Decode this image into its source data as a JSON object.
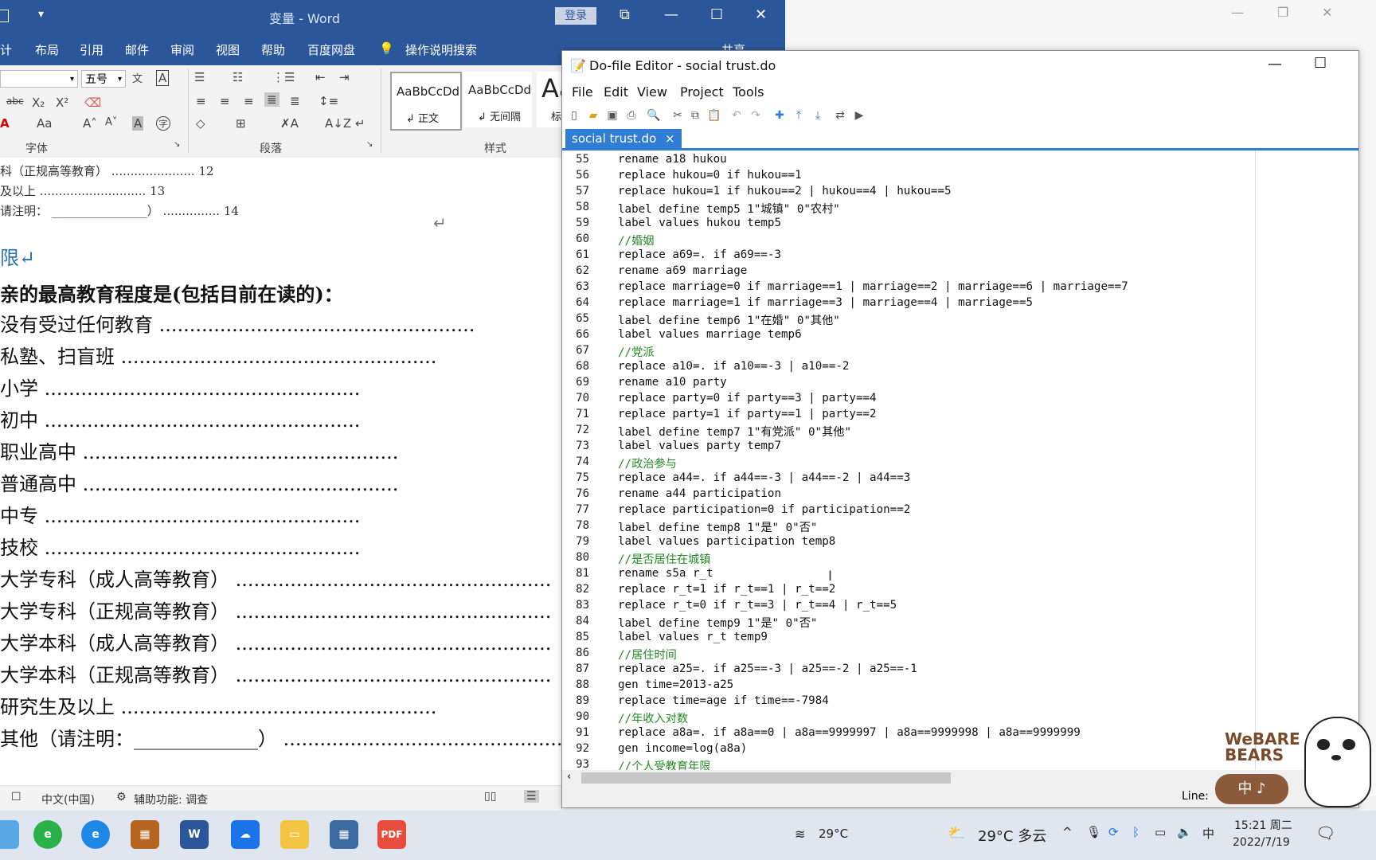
{
  "word": {
    "title": "变量 - Word",
    "quick_access": "▾",
    "login_label": "登录",
    "menu": [
      "计",
      "布局",
      "引用",
      "邮件",
      "审阅",
      "视图",
      "帮助",
      "百度网盘",
      "操作说明搜索"
    ],
    "share_label": "共享",
    "font_size": "五号",
    "groups": {
      "font": "字体",
      "paragraph": "段落",
      "styles": "样式"
    },
    "style_cards": [
      {
        "preview": "AaBbCcDd",
        "name": "↲ 正文"
      },
      {
        "preview": "AaBbCcDd",
        "name": "↲ 无间隔"
      },
      {
        "preview": "Aa",
        "name": "标"
      }
    ],
    "toc": [
      {
        "text": "科（正规高等教育）",
        "page": "12"
      },
      {
        "text": "及以上",
        "page": "13"
      },
      {
        "text": "请注明：",
        "page": "14"
      }
    ],
    "heading_fragment": "限↵",
    "question": "亲的最高教育程度是(包括目前在读的)：",
    "options": [
      "没有受过任何教育",
      "私塾、扫盲班",
      "小学",
      "初中",
      "职业高中",
      "普通高中",
      "中专",
      "技校",
      "大学专科（成人高等教育）",
      "大学专科（正规高等教育）",
      "大学本科（成人高等教育）",
      "大学本科（正规高等教育）",
      "研究生及以上",
      "其他（请注明：_____________）"
    ],
    "status": {
      "language": "中文(中国)",
      "accessibility": "辅助功能: 调查"
    }
  },
  "stata": {
    "title": "Do-file Editor - social trust.do",
    "menu": [
      "File",
      "Edit",
      "View",
      "Project",
      "Tools"
    ],
    "tab": "social trust.do",
    "tab_close": "×",
    "status_line": "Line:",
    "lines": [
      {
        "n": "55",
        "code": "rename a18 hukou",
        "type": "code"
      },
      {
        "n": "56",
        "code": "replace hukou=0 if hukou==1",
        "type": "code"
      },
      {
        "n": "57",
        "code": "replace hukou=1 if hukou==2 | hukou==4 | hukou==5",
        "type": "code"
      },
      {
        "n": "58",
        "code": "label define temp5 1\"城镇\" 0\"农村\"",
        "type": "code"
      },
      {
        "n": "59",
        "code": "label values hukou temp5",
        "type": "code"
      },
      {
        "n": "60",
        "code": "//婚姻",
        "type": "comment"
      },
      {
        "n": "61",
        "code": "replace a69=. if a69==-3",
        "type": "code"
      },
      {
        "n": "62",
        "code": "rename a69 marriage",
        "type": "code"
      },
      {
        "n": "63",
        "code": "replace marriage=0 if marriage==1 | marriage==2 | marriage==6 | marriage==7",
        "type": "code"
      },
      {
        "n": "64",
        "code": "replace marriage=1 if marriage==3 | marriage==4 | marriage==5",
        "type": "code"
      },
      {
        "n": "65",
        "code": "label define temp6 1\"在婚\" 0\"其他\"",
        "type": "code"
      },
      {
        "n": "66",
        "code": "label values marriage temp6",
        "type": "code"
      },
      {
        "n": "67",
        "code": "//党派",
        "type": "comment"
      },
      {
        "n": "68",
        "code": "replace a10=. if a10==-3 | a10==-2",
        "type": "code"
      },
      {
        "n": "69",
        "code": "rename a10 party",
        "type": "code"
      },
      {
        "n": "70",
        "code": "replace party=0 if party==3 | party==4",
        "type": "code"
      },
      {
        "n": "71",
        "code": "replace party=1 if party==1 | party==2",
        "type": "code"
      },
      {
        "n": "72",
        "code": "label define temp7 1\"有党派\" 0\"其他\"",
        "type": "code"
      },
      {
        "n": "73",
        "code": "label values party temp7",
        "type": "code"
      },
      {
        "n": "74",
        "code": "//政治参与",
        "type": "comment"
      },
      {
        "n": "75",
        "code": "replace a44=. if a44==-3 | a44==-2 | a44==3",
        "type": "code"
      },
      {
        "n": "76",
        "code": "rename a44 participation",
        "type": "code"
      },
      {
        "n": "77",
        "code": "replace participation=0 if participation==2",
        "type": "code"
      },
      {
        "n": "78",
        "code": "label define temp8 1\"是\" 0\"否\"",
        "type": "code"
      },
      {
        "n": "79",
        "code": "label values participation temp8",
        "type": "code"
      },
      {
        "n": "80",
        "code": "//是否居住在城镇",
        "type": "comment"
      },
      {
        "n": "81",
        "code": "rename s5a r_t",
        "type": "code"
      },
      {
        "n": "82",
        "code": "replace r_t=1 if r_t==1 | r_t==2",
        "type": "code"
      },
      {
        "n": "83",
        "code": "replace r_t=0 if r_t==3 | r_t==4 | r_t==5",
        "type": "code"
      },
      {
        "n": "84",
        "code": "label define temp9 1\"是\" 0\"否\"",
        "type": "code"
      },
      {
        "n": "85",
        "code": "label values r_t temp9",
        "type": "code"
      },
      {
        "n": "86",
        "code": "//居住时间",
        "type": "comment"
      },
      {
        "n": "87",
        "code": "replace a25=. if a25==-3 | a25==-2 | a25==-1",
        "type": "code"
      },
      {
        "n": "88",
        "code": "gen time=2013-a25",
        "type": "code"
      },
      {
        "n": "89",
        "code": "replace time=age if time==-7984",
        "type": "code"
      },
      {
        "n": "90",
        "code": "//年收入对数",
        "type": "comment"
      },
      {
        "n": "91",
        "code": "replace a8a=. if a8a==0 | a8a==9999997 | a8a==9999998 | a8a==9999999",
        "type": "code"
      },
      {
        "n": "92",
        "code": "gen income=log(a8a)",
        "type": "code"
      },
      {
        "n": "93",
        "code": "//个人受教育年限",
        "type": "comment"
      }
    ]
  },
  "taskbar": {
    "weather_left": "29°C",
    "weather_right": "29°C 多云",
    "ime": "中",
    "time": "15:21 周二",
    "date": "2022/7/19",
    "pdf_label": "PDF"
  },
  "mascot": {
    "text": "WeBARE BEARS",
    "ime_text": "中 ♪"
  }
}
